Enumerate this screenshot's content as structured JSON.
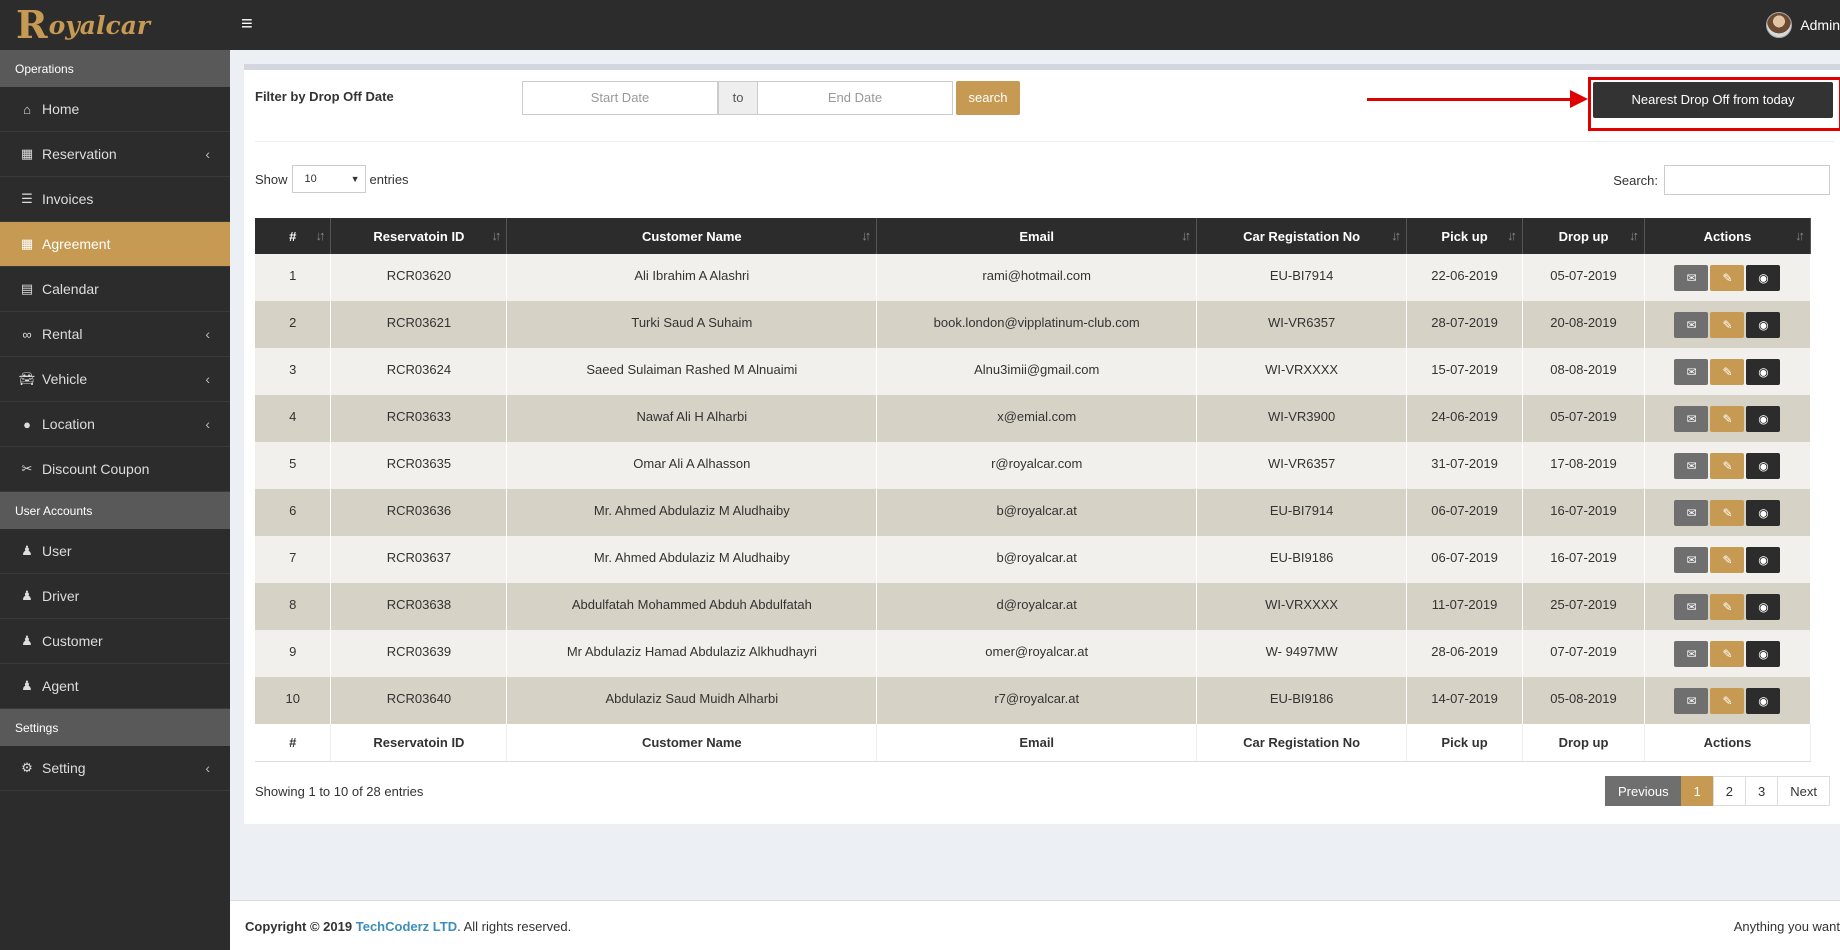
{
  "app": {
    "brand_initial": "R",
    "brand_rest": "oyalcar",
    "user_name": "Admin"
  },
  "sidebar": {
    "sections": [
      {
        "title": "Operations"
      },
      {
        "title": "User Accounts"
      },
      {
        "title": "Settings"
      }
    ],
    "operations": [
      {
        "label": "Home",
        "icon": "home-icon",
        "chevron": false
      },
      {
        "label": "Reservation",
        "icon": "calendar-check-icon",
        "chevron": true
      },
      {
        "label": "Invoices",
        "icon": "list-icon",
        "chevron": false
      },
      {
        "label": "Agreement",
        "icon": "grid-icon",
        "chevron": false,
        "active": true
      },
      {
        "label": "Calendar",
        "icon": "calendar-icon",
        "chevron": false
      },
      {
        "label": "Rental",
        "icon": "link-icon",
        "chevron": true
      },
      {
        "label": "Vehicle",
        "icon": "car-icon",
        "chevron": true
      },
      {
        "label": "Location",
        "icon": "map-marker-icon",
        "chevron": true
      },
      {
        "label": "Discount Coupon",
        "icon": "scissors-icon",
        "chevron": false
      }
    ],
    "user_accounts": [
      {
        "label": "User",
        "icon": "user-icon"
      },
      {
        "label": "Driver",
        "icon": "user-plus-icon"
      },
      {
        "label": "Customer",
        "icon": "users-icon"
      },
      {
        "label": "Agent",
        "icon": "user-secret-icon"
      }
    ],
    "settings": [
      {
        "label": "Setting",
        "icon": "gears-icon",
        "chevron": true
      }
    ]
  },
  "filter": {
    "label": "Filter by Drop Off Date",
    "start_placeholder": "Start Date",
    "to_label": "to",
    "end_placeholder": "End Date",
    "search_label": "search",
    "nearest_label": "Nearest Drop Off from today"
  },
  "table_controls": {
    "show_label": "Show",
    "entries_value": "10",
    "entries_label": "entries",
    "search_label": "Search:"
  },
  "table": {
    "headers": [
      "#",
      "Reservatoin ID",
      "Customer Name",
      "Email",
      "Car Registation No",
      "Pick up",
      "Drop up",
      "Actions"
    ],
    "rows": [
      [
        "1",
        "RCR03620",
        "Ali Ibrahim A Alashri",
        "rami@hotmail.com",
        "EU-BI7914",
        "22-06-2019",
        "05-07-2019"
      ],
      [
        "2",
        "RCR03621",
        "Turki Saud A Suhaim",
        "book.london@vipplatinum-club.com",
        "WI-VR6357",
        "28-07-2019",
        "20-08-2019"
      ],
      [
        "3",
        "RCR03624",
        "Saeed Sulaiman Rashed M Alnuaimi",
        "Alnu3imii@gmail.com",
        "WI-VRXXXX",
        "15-07-2019",
        "08-08-2019"
      ],
      [
        "4",
        "RCR03633",
        "Nawaf Ali H Alharbi",
        "x@emial.com",
        "WI-VR3900",
        "24-06-2019",
        "05-07-2019"
      ],
      [
        "5",
        "RCR03635",
        "Omar Ali A Alhasson",
        "r@royalcar.com",
        "WI-VR6357",
        "31-07-2019",
        "17-08-2019"
      ],
      [
        "6",
        "RCR03636",
        "Mr. Ahmed Abdulaziz M Aludhaiby",
        "b@royalcar.at",
        "EU-BI7914",
        "06-07-2019",
        "16-07-2019"
      ],
      [
        "7",
        "RCR03637",
        "Mr. Ahmed Abdulaziz M Aludhaiby",
        "b@royalcar.at",
        "EU-BI9186",
        "06-07-2019",
        "16-07-2019"
      ],
      [
        "8",
        "RCR03638",
        "Abdulfatah Mohammed Abduh Abdulfatah",
        "d@royalcar.at",
        "WI-VRXXXX",
        "11-07-2019",
        "25-07-2019"
      ],
      [
        "9",
        "RCR03639",
        "Mr Abdulaziz Hamad Abdulaziz Alkhudhayri",
        "omer@royalcar.at",
        "W- 9497MW",
        "28-06-2019",
        "07-07-2019"
      ],
      [
        "10",
        "RCR03640",
        "Abdulaziz Saud Muidh Alharbi",
        "r7@royalcar.at",
        "EU-BI9186",
        "14-07-2019",
        "05-08-2019"
      ]
    ]
  },
  "pagination": {
    "info": "Showing 1 to 10 of 28 entries",
    "prev": "Previous",
    "pages": [
      "1",
      "2",
      "3"
    ],
    "active_page": "1",
    "next": "Next"
  },
  "footer": {
    "copyright": "Copyright © 2019",
    "company": "TechCoderz LTD",
    "rights": ". All rights reserved.",
    "right_text": "Anything you want"
  },
  "colors": {
    "accent": "#c69a52",
    "dark": "#2c2c2c",
    "highlight": "#e00000"
  }
}
